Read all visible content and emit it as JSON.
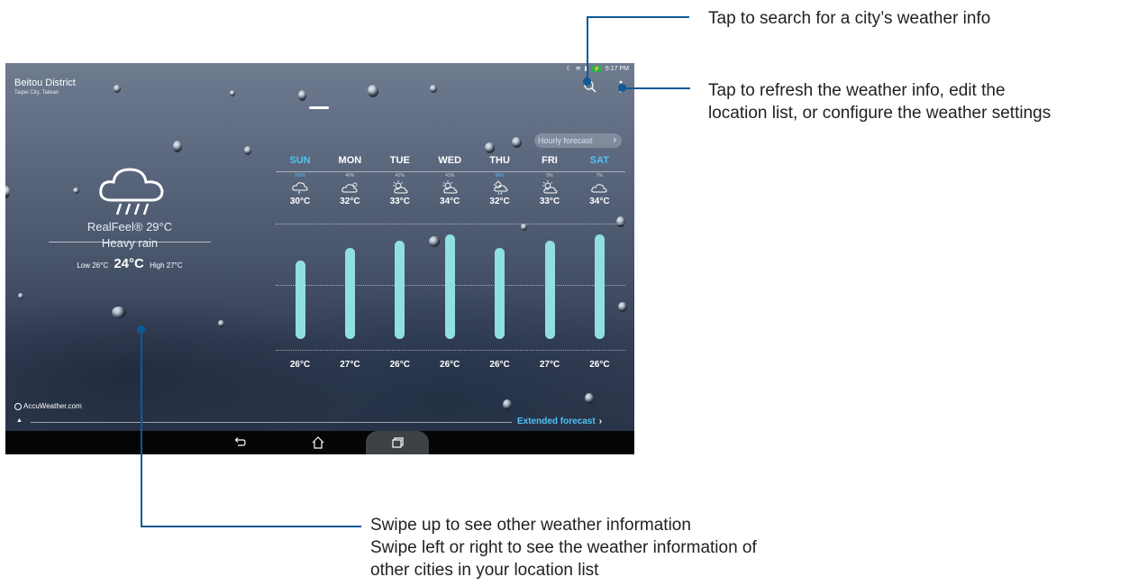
{
  "status_bar": {
    "time": "5:17 PM",
    "battery_label": "⚡"
  },
  "location": {
    "name": "Beitou District",
    "sub": "Taipei City, Taiwan"
  },
  "current": {
    "realfeel": "RealFeel® 29°C",
    "condition": "Heavy rain",
    "low_label": "Low 26°C",
    "temp": "24°C",
    "high_label": "High 27°C",
    "icon": "heavy-rain-cloud-icon"
  },
  "hourly_button": "Hourly forecast",
  "forecast": [
    {
      "day": "SUN",
      "pct": "100%",
      "high": "30°C",
      "low": "26°C",
      "weekend": true,
      "icon": "rain-cloud-icon"
    },
    {
      "day": "MON",
      "pct": "40%",
      "high": "32°C",
      "low": "27°C",
      "weekend": false,
      "icon": "cloud-sun-icon"
    },
    {
      "day": "TUE",
      "pct": "41%",
      "high": "33°C",
      "low": "26°C",
      "weekend": false,
      "icon": "sun-cloud-icon"
    },
    {
      "day": "WED",
      "pct": "41%",
      "high": "34°C",
      "low": "26°C",
      "weekend": false,
      "icon": "sun-cloud-icon"
    },
    {
      "day": "THU",
      "pct": "66%",
      "high": "32°C",
      "low": "26°C",
      "weekend": false,
      "icon": "sun-cloud-rain-icon"
    },
    {
      "day": "FRI",
      "pct": "5%",
      "high": "33°C",
      "low": "27°C",
      "weekend": false,
      "icon": "sun-cloud-icon"
    },
    {
      "day": "SAT",
      "pct": "7%",
      "high": "34°C",
      "low": "26°C",
      "weekend": true,
      "icon": "cloud-icon"
    }
  ],
  "temp_range": {
    "min": 26,
    "max": 34
  },
  "branding": "AccuWeather.com",
  "extended_forecast": "Extended forecast",
  "colors": {
    "accent": "#4fc3f7",
    "bar": "#8fe0df",
    "leader": "#0e5a96"
  },
  "callouts": {
    "search": "Tap to search for a city’s weather info",
    "menu_line1": "Tap to refresh the weather info, edit the",
    "menu_line2": "location list, or configure the weather settings",
    "swipe_line1": "Swipe up to see other weather information",
    "swipe_line2": "Swipe left or right to see the weather information of",
    "swipe_line3": "other cities in your location list"
  }
}
